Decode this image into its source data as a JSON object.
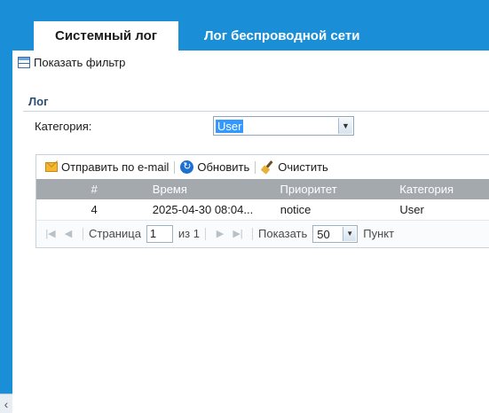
{
  "tabs": [
    {
      "label": "Системный лог",
      "active": true
    },
    {
      "label": "Лог беспроводной сети",
      "active": false
    }
  ],
  "filter_bar": {
    "label": "Показать фильтр",
    "icon": "table-icon"
  },
  "section": {
    "title": "Лог"
  },
  "category": {
    "label": "Категория:",
    "selected": "User",
    "icon": "chevron-down-icon"
  },
  "toolbar": {
    "email_label": "Отправить по e-mail",
    "refresh_label": "Обновить",
    "clear_label": "Очистить"
  },
  "grid": {
    "columns": [
      "#",
      "Время",
      "Приоритет",
      "Категория"
    ],
    "rows": [
      {
        "num": "4",
        "time": "2025-04-30 08:04...",
        "priority": "notice",
        "category": "User"
      }
    ]
  },
  "pager": {
    "page_label": "Страница",
    "page_value": "1",
    "of_label": "из 1",
    "show_label": "Показать",
    "page_size": "50",
    "unit_label": "Пункт"
  },
  "colors": {
    "accent": "#1a8fd8",
    "grid_header": "#a4a9ae",
    "selection": "#3399ff"
  }
}
